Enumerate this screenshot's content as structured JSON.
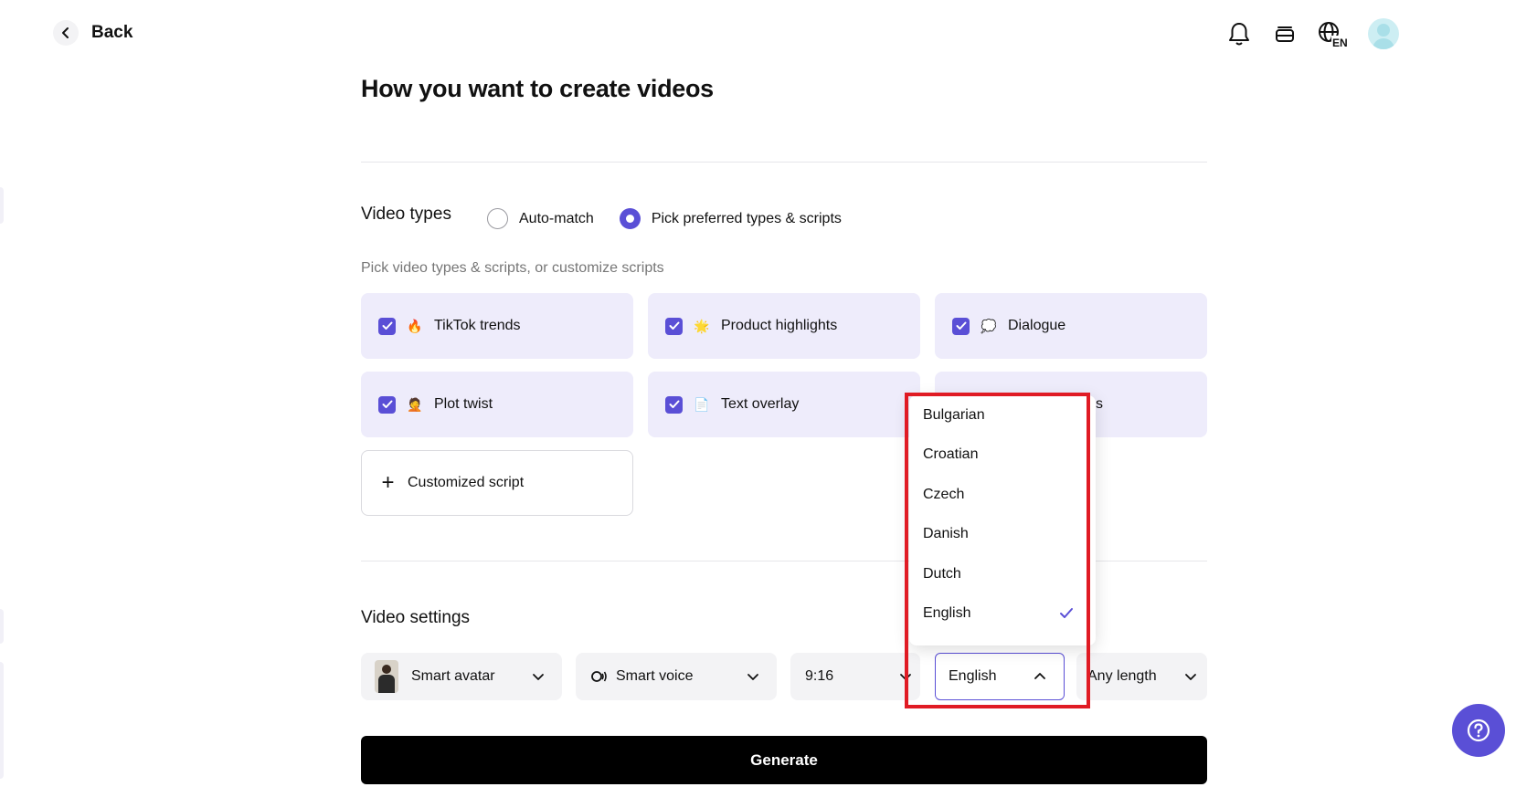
{
  "header": {
    "back_label": "Back",
    "icons": [
      "bell-icon",
      "stack-icon",
      "globe-language-icon",
      "avatar"
    ],
    "language_code": "EN"
  },
  "page": {
    "title": "How you want to create videos"
  },
  "video_types": {
    "title": "Video types",
    "options": [
      {
        "label": "Auto-match",
        "selected": false
      },
      {
        "label": "Pick preferred types & scripts",
        "selected": true
      }
    ],
    "hint": "Pick video types & scripts, or customize scripts",
    "cards": [
      {
        "label": "TikTok trends",
        "emoji": "🔥",
        "checked": true
      },
      {
        "label": "Product highlights",
        "emoji": "🌟",
        "checked": true
      },
      {
        "label": "Dialogue",
        "emoji": "💭",
        "checked": true
      },
      {
        "label": "Plot twist",
        "emoji": "🤦",
        "checked": true
      },
      {
        "label": "Text overlay",
        "emoji": "📄",
        "checked": true
      }
    ],
    "custom_label": "Customized script",
    "hidden_card_fragment": "s"
  },
  "video_settings": {
    "title": "Video settings",
    "avatar_label": "Smart avatar",
    "voice_label": "Smart voice",
    "aspect_label": "9:16",
    "language_label": "English",
    "length_label": "Any length"
  },
  "language_dropdown": {
    "options": [
      "Bulgarian",
      "Croatian",
      "Czech",
      "Danish",
      "Dutch",
      "English"
    ],
    "selected": "English"
  },
  "generate_label": "Generate",
  "colors": {
    "accent": "#5a4fd6",
    "card_bg": "#eeecfb",
    "highlight": "#e01b24"
  }
}
